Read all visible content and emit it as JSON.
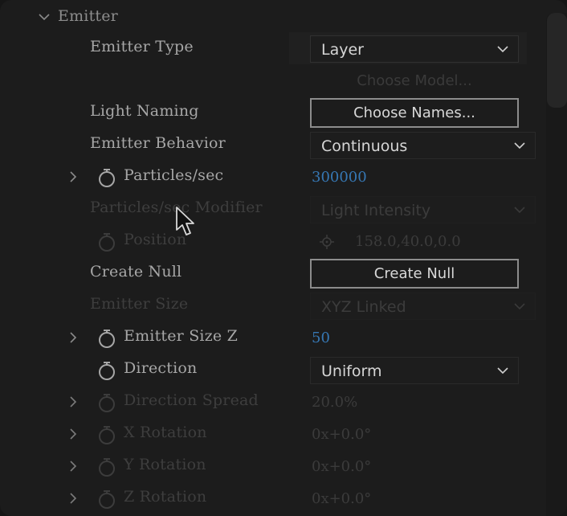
{
  "section": {
    "title": "Emitter"
  },
  "rows": {
    "emitter_type": {
      "label": "Emitter Type",
      "value": "Layer"
    },
    "choose_model": {
      "label": "Choose Model..."
    },
    "light_naming": {
      "label": "Light Naming",
      "button": "Choose Names..."
    },
    "emitter_behavior": {
      "label": "Emitter Behavior",
      "value": "Continuous"
    },
    "particles_sec": {
      "label": "Particles/sec",
      "value": "300000"
    },
    "particles_modifier": {
      "label": "Particles/sec Modifier",
      "value": "Light Intensity"
    },
    "position": {
      "label": "Position",
      "value": "158.0,40.0,0.0"
    },
    "create_null": {
      "label": "Create Null",
      "button": "Create Null"
    },
    "emitter_size": {
      "label": "Emitter Size",
      "value": "XYZ Linked"
    },
    "emitter_size_z": {
      "label": "Emitter Size Z",
      "value": "50"
    },
    "direction": {
      "label": "Direction",
      "value": "Uniform"
    },
    "direction_spread": {
      "label": "Direction Spread",
      "value": "20.0%"
    },
    "x_rotation": {
      "label": "X Rotation",
      "value": "0x+0.0°"
    },
    "y_rotation": {
      "label": "Y Rotation",
      "value": "0x+0.0°"
    },
    "z_rotation": {
      "label": "Z Rotation",
      "value": "0x+0.0°"
    }
  },
  "colors": {
    "value_blue": "#3677b3",
    "panel_bg": "#1c1c1c"
  }
}
